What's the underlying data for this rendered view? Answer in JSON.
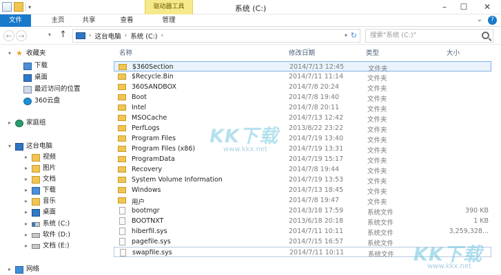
{
  "window": {
    "title": "系统 (C:)",
    "tool_tab": "驱动器工具"
  },
  "ribbon": {
    "tabs": [
      "文件",
      "主页",
      "共享",
      "查看",
      "管理"
    ]
  },
  "address": {
    "crumbs": [
      "这台电脑",
      "系统 (C:)"
    ],
    "search_placeholder": "搜索\"系统 (C:)\""
  },
  "nav": {
    "favorites": "收藏夹",
    "fav_items": [
      "下载",
      "桌面",
      "最近访问的位置",
      "360云盘"
    ],
    "homegroup": "家庭组",
    "this_pc": "这台电脑",
    "pc_items": [
      "视频",
      "图片",
      "文档",
      "下载",
      "音乐",
      "桌面"
    ],
    "drives": [
      "系统 (C:)",
      "软件 (D:)",
      "文档 (E:)"
    ],
    "network": "网络"
  },
  "columns": {
    "name": "名称",
    "date": "修改日期",
    "type": "类型",
    "size": "大小"
  },
  "files": [
    {
      "name": "$360Section",
      "date": "2014/7/13 12:45",
      "type": "文件夹",
      "size": "",
      "kind": "folder"
    },
    {
      "name": "$Recycle.Bin",
      "date": "2014/7/11 11:14",
      "type": "文件夹",
      "size": "",
      "kind": "folder"
    },
    {
      "name": "360SANDBOX",
      "date": "2014/7/8 20:24",
      "type": "文件夹",
      "size": "",
      "kind": "folder"
    },
    {
      "name": "Boot",
      "date": "2014/7/8 19:40",
      "type": "文件夹",
      "size": "",
      "kind": "folder"
    },
    {
      "name": "Intel",
      "date": "2014/7/8 20:11",
      "type": "文件夹",
      "size": "",
      "kind": "folder"
    },
    {
      "name": "MSOCache",
      "date": "2014/7/13 12:42",
      "type": "文件夹",
      "size": "",
      "kind": "folder"
    },
    {
      "name": "PerfLogs",
      "date": "2013/8/22 23:22",
      "type": "文件夹",
      "size": "",
      "kind": "folder"
    },
    {
      "name": "Program Files",
      "date": "2014/7/19 13:40",
      "type": "文件夹",
      "size": "",
      "kind": "folder"
    },
    {
      "name": "Program Files (x86)",
      "date": "2014/7/19 13:31",
      "type": "文件夹",
      "size": "",
      "kind": "folder"
    },
    {
      "name": "ProgramData",
      "date": "2014/7/19 15:17",
      "type": "文件夹",
      "size": "",
      "kind": "folder"
    },
    {
      "name": "Recovery",
      "date": "2014/7/8 19:44",
      "type": "文件夹",
      "size": "",
      "kind": "folder"
    },
    {
      "name": "System Volume Information",
      "date": "2014/7/19 13:53",
      "type": "文件夹",
      "size": "",
      "kind": "folder"
    },
    {
      "name": "Windows",
      "date": "2014/7/13 18:45",
      "type": "文件夹",
      "size": "",
      "kind": "folder"
    },
    {
      "name": "用户",
      "date": "2014/7/8 19:47",
      "type": "文件夹",
      "size": "",
      "kind": "folder"
    },
    {
      "name": "bootmgr",
      "date": "2014/3/18 17:59",
      "type": "系统文件",
      "size": "390 KB",
      "kind": "file"
    },
    {
      "name": "BOOTNXT",
      "date": "2013/6/18 20:18",
      "type": "系统文件",
      "size": "1 KB",
      "kind": "file"
    },
    {
      "name": "hiberfil.sys",
      "date": "2014/7/11 10:11",
      "type": "系统文件",
      "size": "3,259,328...",
      "kind": "file"
    },
    {
      "name": "pagefile.sys",
      "date": "2014/7/15 16:57",
      "type": "系统文件",
      "size": "",
      "kind": "file"
    },
    {
      "name": "swapfile.sys",
      "date": "2014/7/11 10:11",
      "type": "系统文件",
      "size": "",
      "kind": "file"
    }
  ],
  "watermark": {
    "logo": "KK下载",
    "url": "www.kkx.net"
  }
}
